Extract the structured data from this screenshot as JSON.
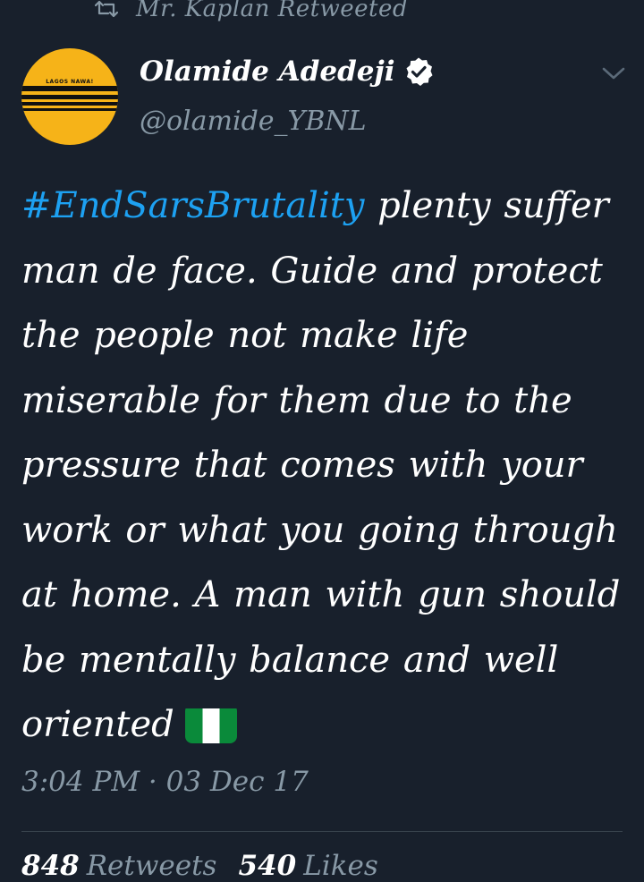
{
  "retweet_header": {
    "icon": "retweet-icon",
    "text": "Mr. Kaplan Retweeted"
  },
  "author": {
    "display_name": "Olamide Adedeji",
    "handle": "@olamide_YBNL",
    "verified": true,
    "avatar_text": "LAGOS NAWA!"
  },
  "tweet": {
    "hashtag": "#EndSarsBrutality",
    "text": " plenty suffer man de face. Guide and protect the people not make life miserable for them due to the pressure that comes with your work or what you going through at home. A man with gun should be mentally balance and well oriented",
    "emoji": "nigeria-flag",
    "timestamp": "3:04 PM · 03 Dec 17"
  },
  "stats": {
    "retweets_count": "848",
    "retweets_label": "Retweets",
    "likes_count": "540",
    "likes_label": "Likes"
  },
  "colors": {
    "background": "#18202c",
    "text": "#ffffff",
    "secondary": "#8899a6",
    "link": "#1da1f2",
    "avatar_bg": "#f6b318",
    "flag_green": "#0a8a3a"
  }
}
